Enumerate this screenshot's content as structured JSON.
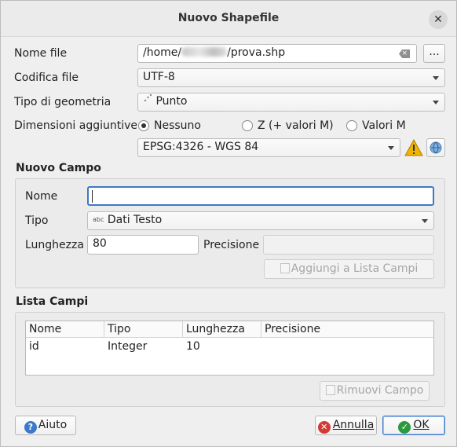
{
  "window": {
    "title": "Nuovo Shapefile",
    "close_glyph": "✕"
  },
  "file": {
    "label": "Nome file",
    "value_prefix": "/home/",
    "value_suffix": "/prova.shp",
    "browse_label": "..."
  },
  "encoding": {
    "label": "Codifica file",
    "value": "UTF-8"
  },
  "geometry": {
    "label": "Tipo di geometria",
    "value": "Punto"
  },
  "dimensions": {
    "label": "Dimensioni aggiuntive",
    "options": [
      "Nessuno",
      "Z (+ valori M)",
      "Valori M"
    ],
    "selected": "Nessuno"
  },
  "crs": {
    "value": "EPSG:4326 - WGS 84"
  },
  "new_field": {
    "title": "Nuovo Campo",
    "name_label": "Nome",
    "name_value": "",
    "type_label": "Tipo",
    "type_icon_text": "abc",
    "type_value": "Dati Testo",
    "length_label": "Lunghezza",
    "length_value": "80",
    "precision_label": "Precisione",
    "precision_value": "",
    "add_button": "Aggiungi a Lista Campi"
  },
  "fields_list": {
    "title": "Lista Campi",
    "columns": [
      "Nome",
      "Tipo",
      "Lunghezza",
      "Precisione"
    ],
    "rows": [
      {
        "nome": "id",
        "tipo": "Integer",
        "lunghezza": "10",
        "precisione": ""
      }
    ],
    "remove_button": "Rimuovi Campo"
  },
  "footer": {
    "help": "Aiuto",
    "cancel": "Annulla",
    "ok": "OK"
  },
  "colors": {
    "accent": "#3c79c9",
    "warning": "#f0b400",
    "ok": "#2a9a3d",
    "cancel": "#d33a33"
  }
}
